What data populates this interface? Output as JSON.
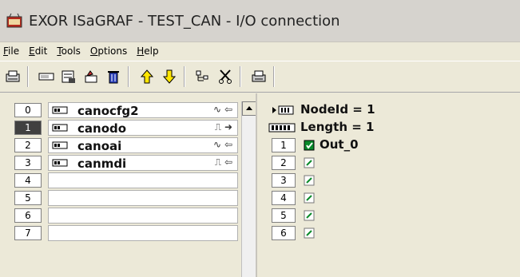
{
  "window": {
    "title": "EXOR ISaGRAF - TEST_CAN - I/O connection"
  },
  "menu": [
    "File",
    "Edit",
    "Tools",
    "Options",
    "Help"
  ],
  "menu_underline": [
    "F",
    "E",
    "T",
    "O",
    "H"
  ],
  "toolbar_icons": [
    "print-preview-icon",
    "board-icon",
    "board-params-icon",
    "board-edit-icon",
    "delete-icon",
    "move-up-icon",
    "move-down-icon",
    "tree-icon",
    "cut-icon",
    "print-icon"
  ],
  "boards": [
    {
      "index": "0",
      "name": "canocfg2",
      "type": "∿",
      "dir": "⇦"
    },
    {
      "index": "1",
      "name": "canodo",
      "type": "⎍",
      "dir": "➜"
    },
    {
      "index": "2",
      "name": "canoai",
      "type": "∿",
      "dir": "⇦"
    },
    {
      "index": "3",
      "name": "canmdi",
      "type": "⎍",
      "dir": "⇦"
    },
    {
      "index": "4",
      "name": ""
    },
    {
      "index": "5",
      "name": ""
    },
    {
      "index": "6",
      "name": ""
    },
    {
      "index": "7",
      "name": ""
    }
  ],
  "selected_board_index": 1,
  "detail": {
    "node": "NodeId = 1",
    "length": "Length = 1",
    "channels": [
      {
        "index": "1",
        "name": "Out_0",
        "active": true
      },
      {
        "index": "2",
        "name": ""
      },
      {
        "index": "3",
        "name": ""
      },
      {
        "index": "4",
        "name": ""
      },
      {
        "index": "5",
        "name": ""
      },
      {
        "index": "6",
        "name": ""
      }
    ]
  },
  "colors": {
    "background": "#ece9d8",
    "selected_index": "#404040",
    "active_var": "#0a8a2a"
  }
}
